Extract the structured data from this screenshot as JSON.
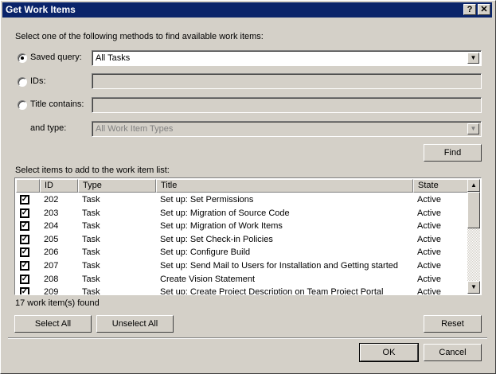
{
  "window": {
    "title": "Get Work Items",
    "help_label": "?",
    "close_label": "✕"
  },
  "instructions": "Select one of the following methods to find available work items:",
  "saved_query": {
    "label": "Saved query:",
    "value": "All Tasks",
    "selected": true
  },
  "ids": {
    "label": "IDs:",
    "value": "",
    "selected": false
  },
  "title_contains": {
    "label": "Title contains:",
    "value": "",
    "selected": false
  },
  "type": {
    "label": "and type:",
    "value": "All Work Item Types"
  },
  "find_label": "Find",
  "list_label": "Select items to add to the work item list:",
  "columns": [
    "",
    "ID",
    "Type",
    "Title",
    "State"
  ],
  "rows": [
    {
      "checked": true,
      "id": "202",
      "type": "Task",
      "title": "Set up: Set Permissions",
      "state": "Active"
    },
    {
      "checked": true,
      "id": "203",
      "type": "Task",
      "title": "Set up: Migration of Source Code",
      "state": "Active"
    },
    {
      "checked": true,
      "id": "204",
      "type": "Task",
      "title": "Set up: Migration of Work Items",
      "state": "Active"
    },
    {
      "checked": true,
      "id": "205",
      "type": "Task",
      "title": "Set up: Set Check-in Policies",
      "state": "Active"
    },
    {
      "checked": true,
      "id": "206",
      "type": "Task",
      "title": "Set up: Configure Build",
      "state": "Active"
    },
    {
      "checked": true,
      "id": "207",
      "type": "Task",
      "title": "Set up: Send Mail to Users for Installation and Getting started",
      "state": "Active"
    },
    {
      "checked": true,
      "id": "208",
      "type": "Task",
      "title": "Create Vision Statement",
      "state": "Active"
    },
    {
      "checked": true,
      "id": "209",
      "type": "Task",
      "title": "Set up: Create Project Description on Team Project Portal",
      "state": "Active"
    }
  ],
  "found_text": "17 work item(s) found",
  "buttons": {
    "select_all": "Select All",
    "unselect_all": "Unselect All",
    "reset": "Reset",
    "ok": "OK",
    "cancel": "Cancel"
  },
  "colors": {
    "titlebar": "#0a246a",
    "face": "#d4d0c8"
  }
}
